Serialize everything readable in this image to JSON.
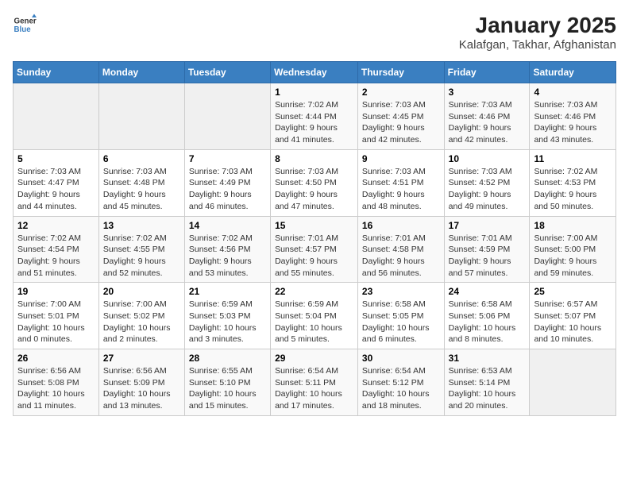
{
  "logo": {
    "general": "General",
    "blue": "Blue"
  },
  "title": "January 2025",
  "subtitle": "Kalafgan, Takhar, Afghanistan",
  "days_header": [
    "Sunday",
    "Monday",
    "Tuesday",
    "Wednesday",
    "Thursday",
    "Friday",
    "Saturday"
  ],
  "weeks": [
    [
      {
        "day": "",
        "info": ""
      },
      {
        "day": "",
        "info": ""
      },
      {
        "day": "",
        "info": ""
      },
      {
        "day": "1",
        "info": "Sunrise: 7:02 AM\nSunset: 4:44 PM\nDaylight: 9 hours and 41 minutes."
      },
      {
        "day": "2",
        "info": "Sunrise: 7:03 AM\nSunset: 4:45 PM\nDaylight: 9 hours and 42 minutes."
      },
      {
        "day": "3",
        "info": "Sunrise: 7:03 AM\nSunset: 4:46 PM\nDaylight: 9 hours and 42 minutes."
      },
      {
        "day": "4",
        "info": "Sunrise: 7:03 AM\nSunset: 4:46 PM\nDaylight: 9 hours and 43 minutes."
      }
    ],
    [
      {
        "day": "5",
        "info": "Sunrise: 7:03 AM\nSunset: 4:47 PM\nDaylight: 9 hours and 44 minutes."
      },
      {
        "day": "6",
        "info": "Sunrise: 7:03 AM\nSunset: 4:48 PM\nDaylight: 9 hours and 45 minutes."
      },
      {
        "day": "7",
        "info": "Sunrise: 7:03 AM\nSunset: 4:49 PM\nDaylight: 9 hours and 46 minutes."
      },
      {
        "day": "8",
        "info": "Sunrise: 7:03 AM\nSunset: 4:50 PM\nDaylight: 9 hours and 47 minutes."
      },
      {
        "day": "9",
        "info": "Sunrise: 7:03 AM\nSunset: 4:51 PM\nDaylight: 9 hours and 48 minutes."
      },
      {
        "day": "10",
        "info": "Sunrise: 7:03 AM\nSunset: 4:52 PM\nDaylight: 9 hours and 49 minutes."
      },
      {
        "day": "11",
        "info": "Sunrise: 7:02 AM\nSunset: 4:53 PM\nDaylight: 9 hours and 50 minutes."
      }
    ],
    [
      {
        "day": "12",
        "info": "Sunrise: 7:02 AM\nSunset: 4:54 PM\nDaylight: 9 hours and 51 minutes."
      },
      {
        "day": "13",
        "info": "Sunrise: 7:02 AM\nSunset: 4:55 PM\nDaylight: 9 hours and 52 minutes."
      },
      {
        "day": "14",
        "info": "Sunrise: 7:02 AM\nSunset: 4:56 PM\nDaylight: 9 hours and 53 minutes."
      },
      {
        "day": "15",
        "info": "Sunrise: 7:01 AM\nSunset: 4:57 PM\nDaylight: 9 hours and 55 minutes."
      },
      {
        "day": "16",
        "info": "Sunrise: 7:01 AM\nSunset: 4:58 PM\nDaylight: 9 hours and 56 minutes."
      },
      {
        "day": "17",
        "info": "Sunrise: 7:01 AM\nSunset: 4:59 PM\nDaylight: 9 hours and 57 minutes."
      },
      {
        "day": "18",
        "info": "Sunrise: 7:00 AM\nSunset: 5:00 PM\nDaylight: 9 hours and 59 minutes."
      }
    ],
    [
      {
        "day": "19",
        "info": "Sunrise: 7:00 AM\nSunset: 5:01 PM\nDaylight: 10 hours and 0 minutes."
      },
      {
        "day": "20",
        "info": "Sunrise: 7:00 AM\nSunset: 5:02 PM\nDaylight: 10 hours and 2 minutes."
      },
      {
        "day": "21",
        "info": "Sunrise: 6:59 AM\nSunset: 5:03 PM\nDaylight: 10 hours and 3 minutes."
      },
      {
        "day": "22",
        "info": "Sunrise: 6:59 AM\nSunset: 5:04 PM\nDaylight: 10 hours and 5 minutes."
      },
      {
        "day": "23",
        "info": "Sunrise: 6:58 AM\nSunset: 5:05 PM\nDaylight: 10 hours and 6 minutes."
      },
      {
        "day": "24",
        "info": "Sunrise: 6:58 AM\nSunset: 5:06 PM\nDaylight: 10 hours and 8 minutes."
      },
      {
        "day": "25",
        "info": "Sunrise: 6:57 AM\nSunset: 5:07 PM\nDaylight: 10 hours and 10 minutes."
      }
    ],
    [
      {
        "day": "26",
        "info": "Sunrise: 6:56 AM\nSunset: 5:08 PM\nDaylight: 10 hours and 11 minutes."
      },
      {
        "day": "27",
        "info": "Sunrise: 6:56 AM\nSunset: 5:09 PM\nDaylight: 10 hours and 13 minutes."
      },
      {
        "day": "28",
        "info": "Sunrise: 6:55 AM\nSunset: 5:10 PM\nDaylight: 10 hours and 15 minutes."
      },
      {
        "day": "29",
        "info": "Sunrise: 6:54 AM\nSunset: 5:11 PM\nDaylight: 10 hours and 17 minutes."
      },
      {
        "day": "30",
        "info": "Sunrise: 6:54 AM\nSunset: 5:12 PM\nDaylight: 10 hours and 18 minutes."
      },
      {
        "day": "31",
        "info": "Sunrise: 6:53 AM\nSunset: 5:14 PM\nDaylight: 10 hours and 20 minutes."
      },
      {
        "day": "",
        "info": ""
      }
    ]
  ]
}
